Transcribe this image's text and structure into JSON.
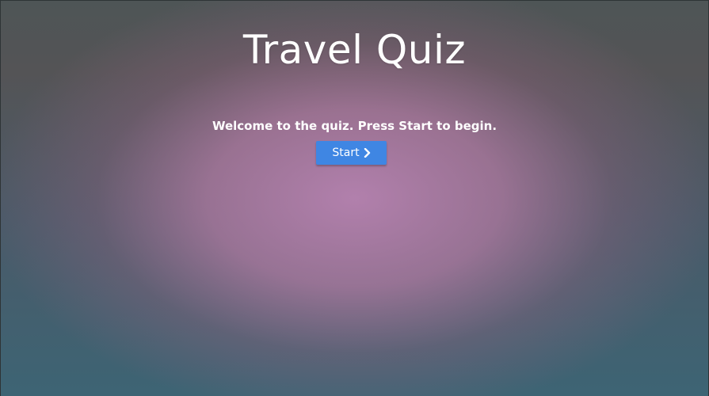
{
  "quiz": {
    "title": "Travel Quiz",
    "welcome": "Welcome to the quiz. Press Start to begin.",
    "start_label": "Start",
    "start_icon": "chevron-right-icon"
  },
  "colors": {
    "button": "#3f86e3",
    "text": "#ffffff"
  }
}
